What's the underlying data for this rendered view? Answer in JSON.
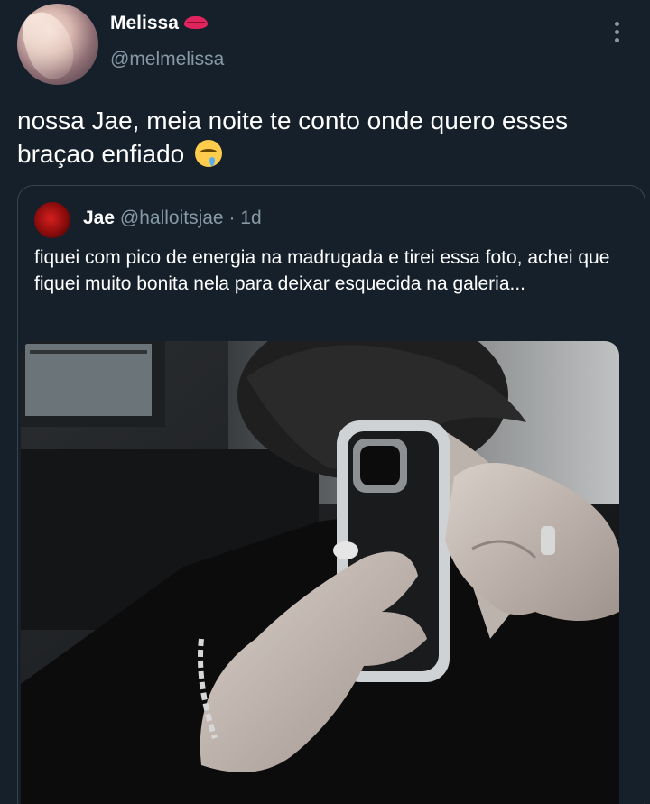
{
  "tweet": {
    "author_name": "Melissa",
    "author_handle": "@melmelissa",
    "text": "nossa Jae, meia noite te conto onde quero esses braçao enfiado",
    "name_emoji_icon": "kiss-mark-icon",
    "text_emoji_icon": "drooling-face-icon"
  },
  "quoted": {
    "author_name": "Jae",
    "author_handle": "@halloitsjae",
    "separator": "·",
    "age": "1d",
    "text": "fiquei com pico de energia na madrugada e tirei essa foto, achei que fiquei muito bonita nela para deixar esquecida na galeria...",
    "media_description": "mirror selfie photo"
  },
  "colors": {
    "background": "#15202b",
    "secondary_text": "#8899a6",
    "border": "#38444d",
    "accent": "#e0245e"
  }
}
